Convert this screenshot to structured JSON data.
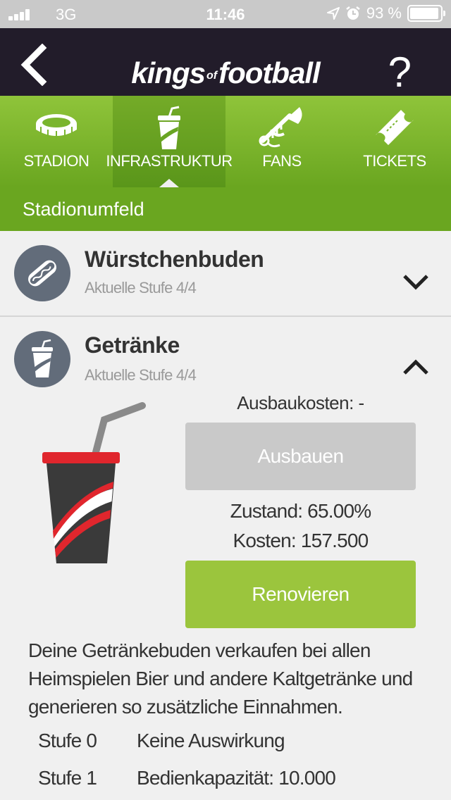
{
  "status_bar": {
    "carrier": "3G",
    "time": "11:46",
    "battery": "93 %",
    "icons": [
      "signal-icon",
      "location-icon",
      "alarm-icon",
      "battery-icon"
    ]
  },
  "header": {
    "logo_left": "kings",
    "logo_of": "of",
    "logo_right": "football",
    "help": "?",
    "icons": [
      "back-arrow-icon"
    ]
  },
  "tabs": [
    {
      "label": "STADION",
      "icon": "stadium-icon",
      "active": false
    },
    {
      "label": "INFRASTRUKTUR",
      "icon": "drink-cup-icon",
      "active": true
    },
    {
      "label": "FANS",
      "icon": "trumpet-icon",
      "active": false
    },
    {
      "label": "TICKETS",
      "icon": "ticket-icon",
      "active": false
    }
  ],
  "section": {
    "title": "Stadionumfeld"
  },
  "items": [
    {
      "title": "Würstchenbuden",
      "subtitle": "Aktuelle Stufe 4/4",
      "icon": "hotdog-icon",
      "expanded": false
    },
    {
      "title": "Getränke",
      "subtitle": "Aktuelle Stufe 4/4",
      "icon": "drink-cup-icon",
      "expanded": true
    }
  ],
  "detail": {
    "upgrade_cost": "Ausbaukosten: -",
    "build_button": "Ausbauen",
    "condition": "Zustand: 65.00%",
    "costs": "Kosten: 157.500",
    "renovate_button": "Renovieren",
    "description": "Deine Getränkebuden verkaufen bei allen Heimspielen Bier und andere Kaltgetränke und generieren so zusätzliche Einnahmen.",
    "levels": [
      {
        "level": "Stufe 0",
        "effect": "Keine Auswirkung"
      },
      {
        "level": "Stufe 1",
        "effect": "Bedienkapazität: 10.000"
      }
    ]
  },
  "colors": {
    "header_bg": "#221c2a",
    "tab_green": "#8fc43a",
    "section_green": "#6aa620",
    "renovate_green": "#9bc53d",
    "disabled_gray": "#c9c9c9",
    "icon_circle": "#626c7a",
    "cup_red": "#e0262d",
    "cup_dark": "#3a3a3a"
  }
}
